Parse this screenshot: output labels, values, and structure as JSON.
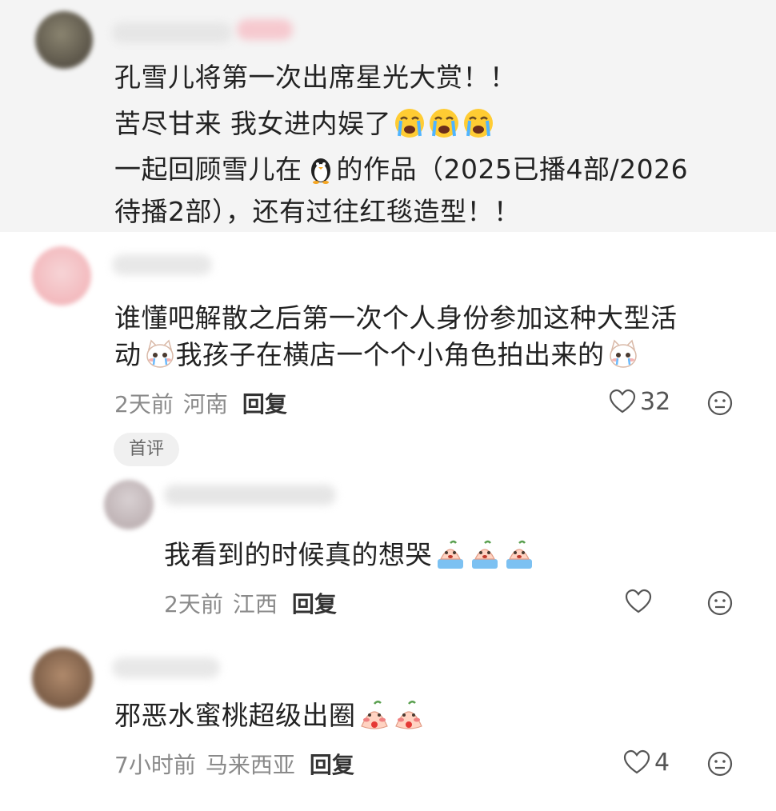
{
  "post": {
    "lines": [
      "孔雪儿将第一次出席星光大赏！！",
      "苦尽甘来 我女进内娱了",
      "一起回顾雪儿在",
      "的作品（2025已播4部/2026",
      "待播2部），还有过往红毯造型！！"
    ]
  },
  "comments": [
    {
      "text_a": "谁懂吧解散之后第一次个人身份参加这种大型活",
      "text_b_prefix": "动",
      "text_b_mid": "我孩子在横店一个个小角色拍出来的",
      "time": "2天前",
      "location": "河南",
      "reply_label": "回复",
      "likes": "32",
      "badge": "首评"
    },
    {
      "text": "我看到的时候真的想哭",
      "time": "2天前",
      "location": "江西",
      "reply_label": "回复",
      "likes": ""
    },
    {
      "text": "邪恶水蜜桃超级出圈",
      "time": "7小时前",
      "location": "马来西亚",
      "reply_label": "回复",
      "likes": "4"
    }
  ],
  "icons": {
    "like": "heart-outline-icon",
    "react": "neutral-face-icon",
    "crying": "loudly-crying-face-emoji",
    "penguin": "penguin-emoji",
    "cat": "crying-cat-sticker",
    "peach_cry": "crying-peach-sticker",
    "peach_shy": "blushing-peach-sticker"
  }
}
